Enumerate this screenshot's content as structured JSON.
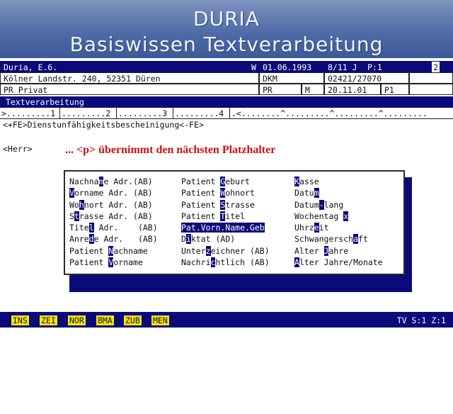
{
  "title": {
    "line1": "DURIA",
    "line2": "Basiswissen Textverarbeitung"
  },
  "patient": {
    "row1": {
      "name": "Duria, E.6.",
      "flag": "W",
      "date": "01.06.1993",
      "field1": "8/11 J",
      "field2": "P:1",
      "marker": "2"
    },
    "row2": {
      "address": "Kölner Landstr. 240, 52351 Düren",
      "field1": "DKM",
      "phone": "02421/27070"
    },
    "row3": {
      "insurance": "PR Privat",
      "field1": "PR",
      "field2": "M",
      "date": "20.11.01",
      "field3": "P1"
    }
  },
  "module": {
    "label": "Textverarbeitung"
  },
  "ruler": {
    "seg1": ">.........1",
    "seg2": ".........2",
    "seg3": ".........3",
    "seg4": ".........4",
    "seg5": ".<........^.........^.........^........."
  },
  "document": {
    "fe_line": "<+FE>Dienstunfähigkeitsbescheinigung<-FE>",
    "salutation": "<Herr>"
  },
  "hint": "... <p> übernimmt den nächsten Platzhalter",
  "placeholders": {
    "col1": [
      {
        "pre": "Nachna",
        "key": "m",
        "post": "e Adr.(AB)"
      },
      {
        "pre": "",
        "key": "V",
        "post": "orname Adr. (AB)"
      },
      {
        "pre": "Wo",
        "key": "h",
        "post": "nort Adr. (AB)"
      },
      {
        "pre": "S",
        "key": "t",
        "post": "rasse Adr. (AB)"
      },
      {
        "pre": "Tite",
        "key": "l",
        "post": " Adr.    (AB)"
      },
      {
        "pre": "Anre",
        "key": "d",
        "post": "e Adr.   (AB)"
      },
      {
        "pre": "Patient ",
        "key": "N",
        "post": "achname"
      },
      {
        "pre": "Patient ",
        "key": "V",
        "post": "orname"
      }
    ],
    "col2": [
      {
        "pre": "Patient ",
        "key": "G",
        "post": "eburt"
      },
      {
        "pre": "Patient ",
        "key": "W",
        "post": "ohnort"
      },
      {
        "pre": "Patient ",
        "key": "S",
        "post": "trasse"
      },
      {
        "pre": "Patient ",
        "key": "T",
        "post": "itel"
      },
      {
        "pre": "Pat.Vorn.Name.Geb",
        "key": "",
        "post": "",
        "selected": true
      },
      {
        "pre": "D",
        "key": "i",
        "post": "ktat (AD)"
      },
      {
        "pre": "Unter",
        "key": "z",
        "post": "eichner (AB)"
      },
      {
        "pre": "Nachri",
        "key": "c",
        "post": "htlich (AB)"
      }
    ],
    "col3": [
      {
        "pre": "",
        "key": "K",
        "post": "asse"
      },
      {
        "pre": "Datu",
        "key": "m",
        "post": ""
      },
      {
        "pre": "Datum",
        "key": "-",
        "post": "lang"
      },
      {
        "pre": "Wochentag ",
        "key": "x",
        "post": ""
      },
      {
        "pre": "Uhrz",
        "key": "e",
        "post": "it"
      },
      {
        "pre": "Schwangersch",
        "key": "a",
        "post": "ft"
      },
      {
        "pre": "Alter ",
        "key": "J",
        "post": "ahre"
      },
      {
        "pre": "",
        "key": "A",
        "post": "lter Jahre/Monate"
      }
    ]
  },
  "function_keys": [
    "INS",
    "ZEI",
    "NOR",
    "BMA",
    "ZUB",
    "MEN"
  ],
  "status": "TV S:1 Z:1"
}
